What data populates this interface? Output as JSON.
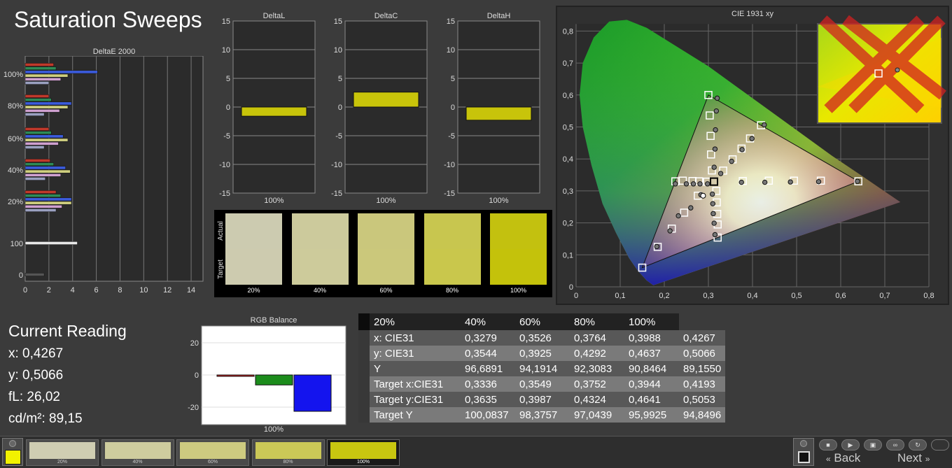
{
  "title": "Saturation Sweeps",
  "deltaE": {
    "title": "DeltaE 2000",
    "x_ticks": [
      "0",
      "2",
      "4",
      "6",
      "8",
      "10",
      "12",
      "14"
    ],
    "row_labels": [
      "100%",
      "80%",
      "60%",
      "40%",
      "20%",
      "100",
      "0"
    ]
  },
  "deltas": [
    {
      "title": "DeltaL",
      "value": -1.6,
      "xlabel": "100%"
    },
    {
      "title": "DeltaC",
      "value": 2.6,
      "xlabel": "100%"
    },
    {
      "title": "DeltaH",
      "value": -2.3,
      "xlabel": "100%"
    }
  ],
  "delta_ticks": [
    "15",
    "10",
    "5",
    "0",
    "-5",
    "-10",
    "-15"
  ],
  "patches": {
    "actual_label": "Actual",
    "target_label": "Target",
    "items": [
      {
        "label": "20%",
        "actual": "#cccbb0",
        "target": "#cdcbaf"
      },
      {
        "label": "40%",
        "actual": "#ccca9c",
        "target": "#cdcb9b"
      },
      {
        "label": "60%",
        "actual": "#cac77c",
        "target": "#cbc87b"
      },
      {
        "label": "80%",
        "actual": "#c8c64f",
        "target": "#c9c74c"
      },
      {
        "label": "100%",
        "actual": "#c3c10f",
        "target": "#c4c20b"
      }
    ]
  },
  "cie": {
    "title": "CIE 1931 xy",
    "x_ticks": [
      "0",
      "0,1",
      "0,2",
      "0,3",
      "0,4",
      "0,5",
      "0,6",
      "0,7",
      "0,8"
    ],
    "y_ticks": [
      "0",
      "0,1",
      "0,2",
      "0,3",
      "0,4",
      "0,5",
      "0,6",
      "0,7",
      "0,8"
    ]
  },
  "reading": {
    "title": "Current Reading",
    "x": "x: 0,4267",
    "y": "y: 0,5066",
    "fl": "fL: 26,02",
    "cd": "cd/m²: 89,15"
  },
  "rgb": {
    "title": "RGB Balance",
    "ticks": [
      "20",
      "0",
      "-20"
    ],
    "xlabel": "100%",
    "colors": {
      "red": "#cc2020",
      "green": "#1c8c1c",
      "blue": "#1414ee"
    }
  },
  "table": {
    "headers": [
      "",
      "20%",
      "40%",
      "60%",
      "80%",
      "100%"
    ],
    "rows": [
      [
        "x: CIE31",
        "0,3279",
        "0,3526",
        "0,3764",
        "0,3988",
        "0,4267"
      ],
      [
        "y: CIE31",
        "0,3544",
        "0,3925",
        "0,4292",
        "0,4637",
        "0,5066"
      ],
      [
        "Y",
        "96,6891",
        "94,1914",
        "92,3083",
        "90,8464",
        "89,1550"
      ],
      [
        "Target x:CIE31",
        "0,3336",
        "0,3549",
        "0,3752",
        "0,3944",
        "0,4193"
      ],
      [
        "Target y:CIE31",
        "0,3635",
        "0,3987",
        "0,4324",
        "0,4641",
        "0,5053"
      ],
      [
        "Target Y",
        "100,0837",
        "98,3757",
        "97,0439",
        "95,9925",
        "94,8496"
      ]
    ]
  },
  "bottom": {
    "swatches": [
      {
        "label": "20%",
        "color": "#cfcdb2"
      },
      {
        "label": "40%",
        "color": "#cecc9e"
      },
      {
        "label": "60%",
        "color": "#cdca80"
      },
      {
        "label": "80%",
        "color": "#cbc857"
      },
      {
        "label": "100%",
        "color": "#c8c610"
      }
    ],
    "back_label": "Back",
    "next_label": "Next"
  },
  "chart_data": [
    {
      "type": "bar",
      "title": "DeltaE 2000",
      "categories": [
        "100%",
        "80%",
        "60%",
        "40%",
        "20%",
        "100",
        "0"
      ],
      "xlim": [
        0,
        15
      ],
      "series_colors": [
        "#c0392b",
        "#2e8b57",
        "#3b5bdb",
        "#cfcf80",
        "#cfa0d0",
        "#9aa0c0"
      ],
      "values": [
        [
          2.4,
          2.6,
          6.1,
          3.6,
          3.0,
          2.0
        ],
        [
          2.0,
          2.2,
          3.9,
          3.6,
          2.9,
          1.6
        ],
        [
          2.0,
          2.2,
          3.2,
          3.6,
          2.8,
          1.6
        ],
        [
          2.1,
          2.4,
          3.4,
          3.8,
          3.0,
          1.7
        ],
        [
          2.6,
          3.0,
          3.9,
          3.9,
          3.1,
          2.6
        ],
        [
          4.4
        ],
        [
          1.6
        ]
      ]
    },
    {
      "type": "bar",
      "title": "DeltaL / DeltaC / DeltaH",
      "categories": [
        "DeltaL",
        "DeltaC",
        "DeltaH"
      ],
      "values": [
        -1.6,
        2.6,
        -2.3
      ],
      "ylim": [
        -15,
        15
      ]
    },
    {
      "type": "bar",
      "title": "RGB Balance",
      "categories": [
        "Red",
        "Green",
        "Blue"
      ],
      "values": [
        -0.8,
        -6.2,
        -22.6
      ],
      "ylim": [
        -25,
        25
      ]
    },
    {
      "type": "scatter",
      "title": "CIE 1931 xy",
      "xlim": [
        0,
        0.8
      ],
      "ylim": [
        0,
        0.8
      ],
      "gamut_target": [
        [
          0.64,
          0.33
        ],
        [
          0.3,
          0.6
        ],
        [
          0.15,
          0.06
        ]
      ],
      "white_point": [
        0.3127,
        0.329
      ],
      "measured_yellow": [
        [
          0.3279,
          0.3544
        ],
        [
          0.3526,
          0.3925
        ],
        [
          0.3764,
          0.4292
        ],
        [
          0.3988,
          0.4637
        ],
        [
          0.4267,
          0.5066
        ]
      ],
      "target_yellow": [
        [
          0.3336,
          0.3635
        ],
        [
          0.3549,
          0.3987
        ],
        [
          0.3752,
          0.4324
        ],
        [
          0.3944,
          0.4641
        ],
        [
          0.4193,
          0.5053
        ]
      ],
      "target_red": [
        [
          0.378,
          0.331
        ],
        [
          0.437,
          0.332
        ],
        [
          0.494,
          0.332
        ],
        [
          0.555,
          0.332
        ],
        [
          0.64,
          0.33
        ]
      ],
      "measured_red": [
        [
          0.375,
          0.327
        ],
        [
          0.428,
          0.327
        ],
        [
          0.486,
          0.328
        ],
        [
          0.55,
          0.329
        ],
        [
          0.638,
          0.33
        ]
      ],
      "target_green": [
        [
          0.308,
          0.364
        ],
        [
          0.306,
          0.414
        ],
        [
          0.305,
          0.472
        ],
        [
          0.303,
          0.536
        ],
        [
          0.3,
          0.6
        ]
      ],
      "measured_green": [
        [
          0.313,
          0.374
        ],
        [
          0.315,
          0.431
        ],
        [
          0.316,
          0.491
        ],
        [
          0.318,
          0.55
        ],
        [
          0.32,
          0.59
        ]
      ],
      "target_blue": [
        [
          0.276,
          0.285
        ],
        [
          0.245,
          0.232
        ],
        [
          0.217,
          0.182
        ],
        [
          0.185,
          0.125
        ],
        [
          0.15,
          0.06
        ]
      ],
      "measured_blue": [
        [
          0.283,
          0.288
        ],
        [
          0.26,
          0.247
        ],
        [
          0.232,
          0.222
        ],
        [
          0.213,
          0.175
        ],
        [
          0.183,
          0.126
        ]
      ],
      "target_cyan": [
        [
          0.297,
          0.329
        ],
        [
          0.279,
          0.33
        ],
        [
          0.264,
          0.331
        ],
        [
          0.242,
          0.332
        ],
        [
          0.225,
          0.33
        ]
      ],
      "measured_cyan": [
        [
          0.298,
          0.322
        ],
        [
          0.281,
          0.322
        ],
        [
          0.266,
          0.322
        ],
        [
          0.25,
          0.322
        ],
        [
          0.225,
          0.322
        ]
      ],
      "target_magenta": [
        [
          0.318,
          0.3
        ],
        [
          0.319,
          0.264
        ],
        [
          0.32,
          0.228
        ],
        [
          0.321,
          0.195
        ],
        [
          0.321,
          0.154
        ]
      ],
      "measured_magenta": [
        [
          0.309,
          0.29
        ],
        [
          0.31,
          0.26
        ],
        [
          0.311,
          0.229
        ],
        [
          0.313,
          0.199
        ],
        [
          0.315,
          0.163
        ]
      ]
    }
  ]
}
